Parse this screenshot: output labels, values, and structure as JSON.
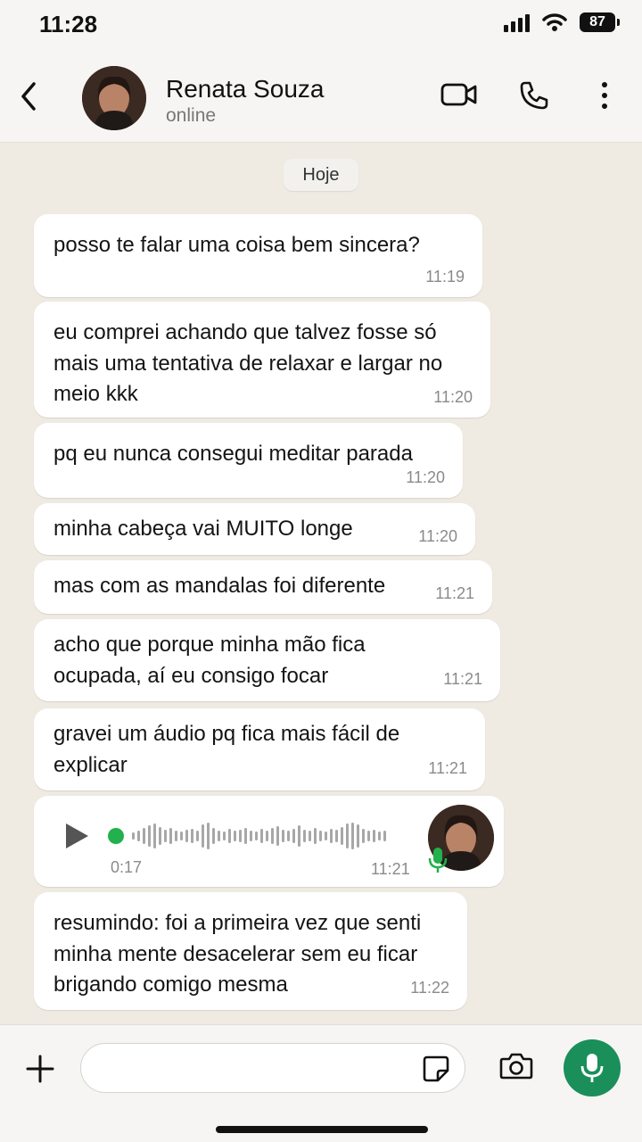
{
  "status_bar": {
    "time": "11:28",
    "battery": "87"
  },
  "header": {
    "name": "Renata Souza",
    "status": "online"
  },
  "chat": {
    "date_label": "Hoje",
    "messages": [
      {
        "text": "posso te falar uma coisa bem sincera?",
        "time": "11:19"
      },
      {
        "text": "eu comprei achando que talvez fosse só\nmais uma tentativa de relaxar e largar no\nmeio kkk",
        "time": "11:20"
      },
      {
        "text": "pq eu nunca consegui meditar parada",
        "time": "11:20"
      },
      {
        "text": "minha cabeça vai MUITO longe",
        "time": "11:20"
      },
      {
        "text": "mas com as mandalas foi diferente",
        "time": "11:21"
      },
      {
        "text": "acho que porque minha mão fica\nocupada, aí eu consigo focar",
        "time": "11:21"
      },
      {
        "text": "gravei um áudio pq fica mais fácil de\nexplicar",
        "time": "11:21"
      },
      {
        "text": "resumindo: foi a primeira vez que senti\nminha mente desacelerar sem eu ficar\nbrigando comigo mesma",
        "time": "11:22"
      }
    ],
    "audio": {
      "duration": "0:17",
      "time": "11:21"
    }
  },
  "colors": {
    "accent": "#1a8f5a",
    "background": "#efeae2",
    "bubble": "#ffffff"
  },
  "icons": [
    "back-arrow-icon",
    "video-call-icon",
    "phone-icon",
    "more-vert-icon",
    "play-icon",
    "mic-icon",
    "plus-icon",
    "sticker-icon",
    "camera-icon"
  ]
}
